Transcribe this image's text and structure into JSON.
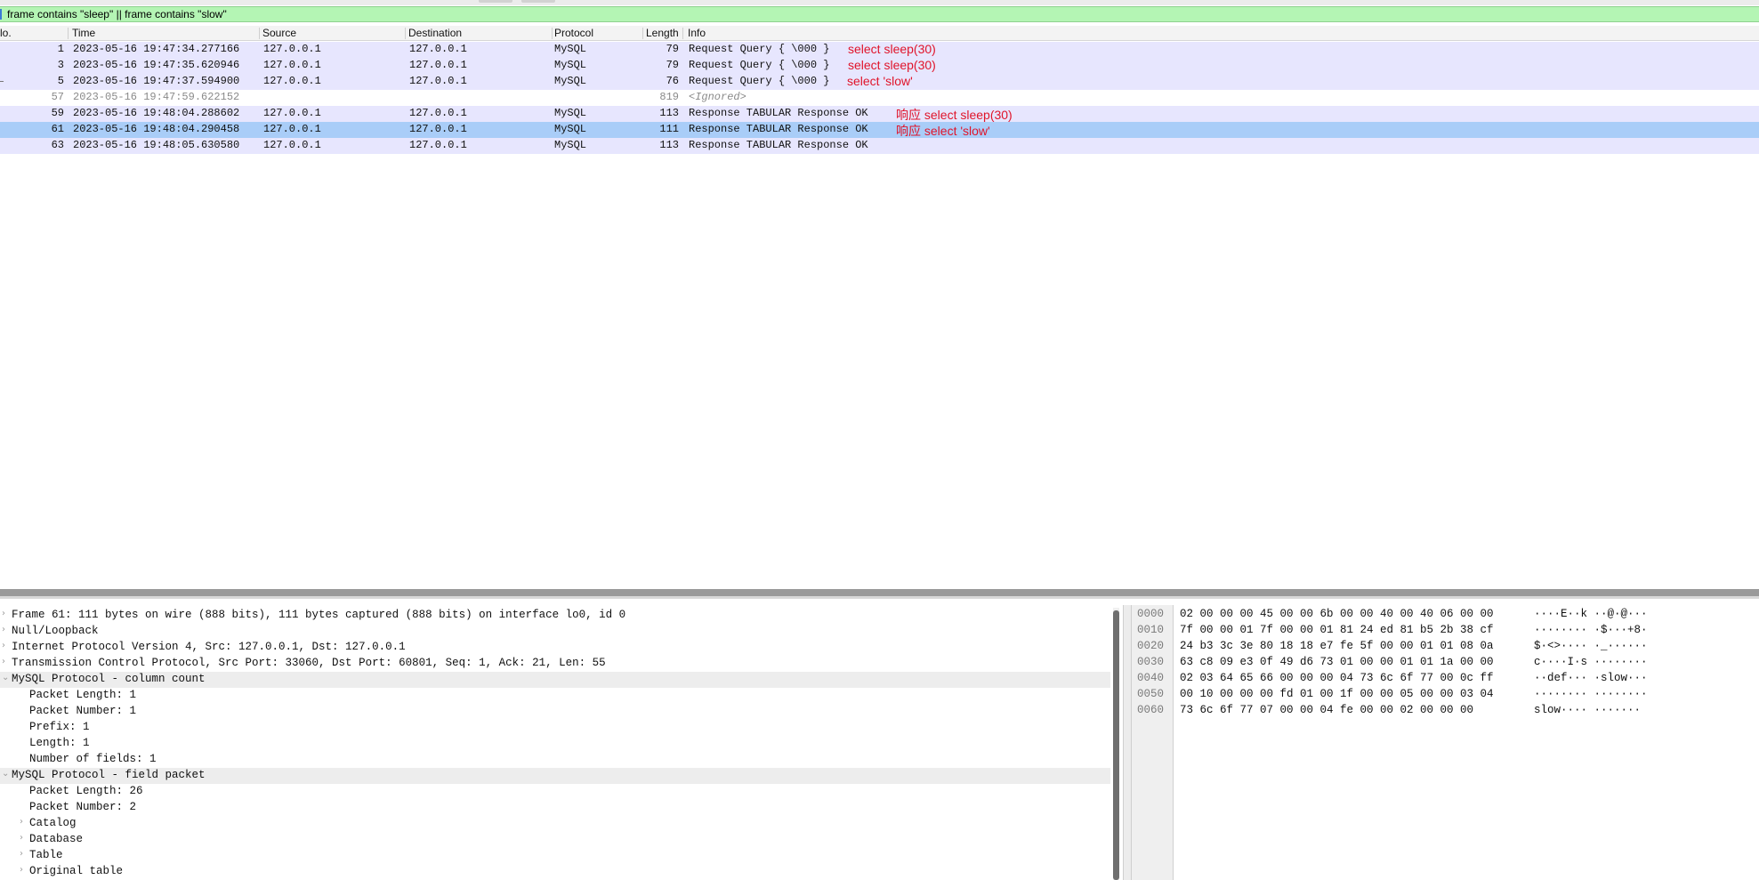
{
  "filter": {
    "value": "frame contains \"sleep\" || frame contains \"slow\""
  },
  "columns": {
    "no": "lo.",
    "time": "Time",
    "source": "Source",
    "destination": "Destination",
    "protocol": "Protocol",
    "length": "Length",
    "info": "Info"
  },
  "packets": [
    {
      "no": "1",
      "time": "2023-05-16 19:47:34.277166",
      "source": "127.0.0.1",
      "destination": "127.0.0.1",
      "protocol": "MySQL",
      "length": "79",
      "info": "Request Query { \\000 }",
      "annotation": "select sleep(30)",
      "state": "mysql"
    },
    {
      "no": "3",
      "time": "2023-05-16 19:47:35.620946",
      "source": "127.0.0.1",
      "destination": "127.0.0.1",
      "protocol": "MySQL",
      "length": "79",
      "info": "Request Query { \\000 }",
      "annotation": "select sleep(30)",
      "state": "mysql"
    },
    {
      "no": "5",
      "time": "2023-05-16 19:47:37.594900",
      "source": "127.0.0.1",
      "destination": "127.0.0.1",
      "protocol": "MySQL",
      "length": "76",
      "info": "Request Query { \\000 }",
      "annotation": "select 'slow'",
      "state": "mysql"
    },
    {
      "no": "57",
      "time": "2023-05-16 19:47:59.622152",
      "source": "",
      "destination": "",
      "protocol": "",
      "length": "819",
      "info": "<Ignored>",
      "annotation": "",
      "state": "ignored"
    },
    {
      "no": "59",
      "time": "2023-05-16 19:48:04.288602",
      "source": "127.0.0.1",
      "destination": "127.0.0.1",
      "protocol": "MySQL",
      "length": "113",
      "info": "Response TABULAR Response  OK",
      "annotation": "响应 select sleep(30)",
      "state": "mysql"
    },
    {
      "no": "61",
      "time": "2023-05-16 19:48:04.290458",
      "source": "127.0.0.1",
      "destination": "127.0.0.1",
      "protocol": "MySQL",
      "length": "111",
      "info": "Response TABULAR Response  OK",
      "annotation": "响应 select 'slow'",
      "state": "selected"
    },
    {
      "no": "63",
      "time": "2023-05-16 19:48:05.630580",
      "source": "127.0.0.1",
      "destination": "127.0.0.1",
      "protocol": "MySQL",
      "length": "113",
      "info": "Response TABULAR Response  OK",
      "annotation": "",
      "state": "mysql"
    }
  ],
  "details": [
    {
      "text": "Frame 61: 111 bytes on wire (888 bits), 111 bytes captured (888 bits) on interface lo0, id 0",
      "level": 0,
      "expander": "›",
      "highlight": false
    },
    {
      "text": "Null/Loopback",
      "level": 0,
      "expander": "›",
      "highlight": false
    },
    {
      "text": "Internet Protocol Version 4, Src: 127.0.0.1, Dst: 127.0.0.1",
      "level": 0,
      "expander": "›",
      "highlight": false
    },
    {
      "text": "Transmission Control Protocol, Src Port: 33060, Dst Port: 60801, Seq: 1, Ack: 21, Len: 55",
      "level": 0,
      "expander": "›",
      "highlight": false
    },
    {
      "text": "MySQL Protocol - column count",
      "level": 0,
      "expander": "⌄",
      "highlight": true
    },
    {
      "text": "Packet Length: 1",
      "level": 1,
      "expander": "",
      "highlight": false
    },
    {
      "text": "Packet Number: 1",
      "level": 1,
      "expander": "",
      "highlight": false
    },
    {
      "text": "Prefix: 1",
      "level": 1,
      "expander": "",
      "highlight": false
    },
    {
      "text": "Length: 1",
      "level": 1,
      "expander": "",
      "highlight": false
    },
    {
      "text": "Number of fields: 1",
      "level": 1,
      "expander": "",
      "highlight": false
    },
    {
      "text": "MySQL Protocol - field packet",
      "level": 0,
      "expander": "⌄",
      "highlight": true
    },
    {
      "text": "Packet Length: 26",
      "level": 1,
      "expander": "",
      "highlight": false
    },
    {
      "text": "Packet Number: 2",
      "level": 1,
      "expander": "",
      "highlight": false
    },
    {
      "text": "Catalog",
      "level": 1,
      "expander": "›",
      "highlight": false
    },
    {
      "text": "Database",
      "level": 1,
      "expander": "›",
      "highlight": false
    },
    {
      "text": "Table",
      "level": 1,
      "expander": "›",
      "highlight": false
    },
    {
      "text": "Original table",
      "level": 1,
      "expander": "›",
      "highlight": false
    }
  ],
  "hex": [
    {
      "offset": "0000",
      "bytes": "02 00 00 00 45 00 00 6b  00 00 40 00 40 06 00 00",
      "ascii": "····E··k ··@·@···"
    },
    {
      "offset": "0010",
      "bytes": "7f 00 00 01 7f 00 00 01  81 24 ed 81 b5 2b 38 cf",
      "ascii": "········ ·$···+8·"
    },
    {
      "offset": "0020",
      "bytes": "24 b3 3c 3e 80 18 18 e7  fe 5f 00 00 01 01 08 0a",
      "ascii": "$·<>···· ·_······"
    },
    {
      "offset": "0030",
      "bytes": "63 c8 09 e3 0f 49 d6 73  01 00 00 01 01 1a 00 00",
      "ascii": "c····I·s ········"
    },
    {
      "offset": "0040",
      "bytes": "02 03 64 65 66 00 00 00  04 73 6c 6f 77 00 0c ff",
      "ascii": "··def··· ·slow···"
    },
    {
      "offset": "0050",
      "bytes": "00 10 00 00 00 fd 01 00  1f 00 00 05 00 00 03 04",
      "ascii": "········ ········"
    },
    {
      "offset": "0060",
      "bytes": "73 6c 6f 77 07 00 00 04  fe 00 00 02 00 00 00",
      "ascii": "slow···· ·······"
    }
  ]
}
